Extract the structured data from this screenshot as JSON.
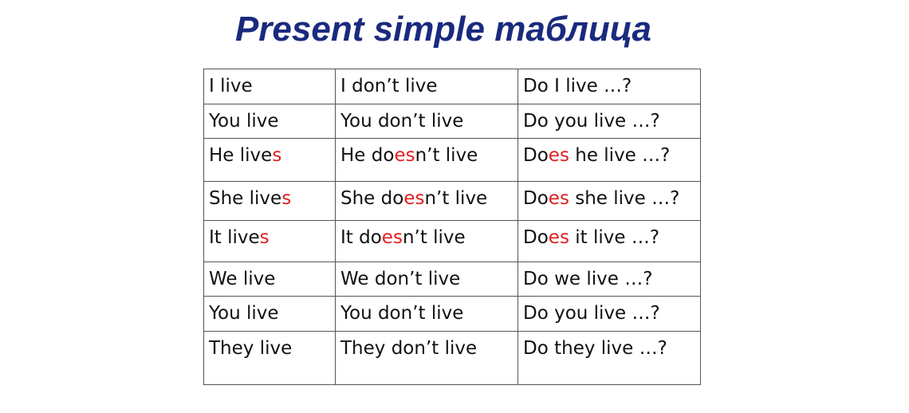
{
  "title": "Present simple таблица",
  "colors": {
    "title": "#1a2a7e",
    "highlight": "#e02020"
  },
  "rows": [
    [
      [
        [
          "I live",
          0
        ]
      ],
      [
        [
          "I don’t live",
          0
        ]
      ],
      [
        [
          "Do I live …?",
          0
        ]
      ]
    ],
    [
      [
        [
          "You live",
          0
        ]
      ],
      [
        [
          "You don’t live",
          0
        ]
      ],
      [
        [
          "Do you live …?",
          0
        ]
      ]
    ],
    [
      [
        [
          "He live",
          0
        ],
        [
          "s",
          1
        ]
      ],
      [
        [
          "He do",
          0
        ],
        [
          "es",
          1
        ],
        [
          "n’t live",
          0
        ]
      ],
      [
        [
          "Do",
          0
        ],
        [
          "es",
          1
        ],
        [
          " he live …?",
          0
        ]
      ]
    ],
    [
      [
        [
          "She live",
          0
        ],
        [
          "s",
          1
        ]
      ],
      [
        [
          "She do",
          0
        ],
        [
          "es",
          1
        ],
        [
          "n’t live",
          0
        ]
      ],
      [
        [
          "Do",
          0
        ],
        [
          "es",
          1
        ],
        [
          " she live …?",
          0
        ]
      ]
    ],
    [
      [
        [
          "It live",
          0
        ],
        [
          "s",
          1
        ]
      ],
      [
        [
          "It do",
          0
        ],
        [
          "es",
          1
        ],
        [
          "n’t live",
          0
        ]
      ],
      [
        [
          "Do",
          0
        ],
        [
          "es",
          1
        ],
        [
          " it live …?",
          0
        ]
      ]
    ],
    [
      [
        [
          "We live",
          0
        ]
      ],
      [
        [
          "We don’t live",
          0
        ]
      ],
      [
        [
          "Do we live …?",
          0
        ]
      ]
    ],
    [
      [
        [
          "You live",
          0
        ]
      ],
      [
        [
          "You don’t live",
          0
        ]
      ],
      [
        [
          "Do you live …?",
          0
        ]
      ]
    ],
    [
      [
        [
          "They live",
          0
        ]
      ],
      [
        [
          "They don’t live",
          0
        ]
      ],
      [
        [
          "Do they live …?",
          0
        ]
      ]
    ]
  ]
}
